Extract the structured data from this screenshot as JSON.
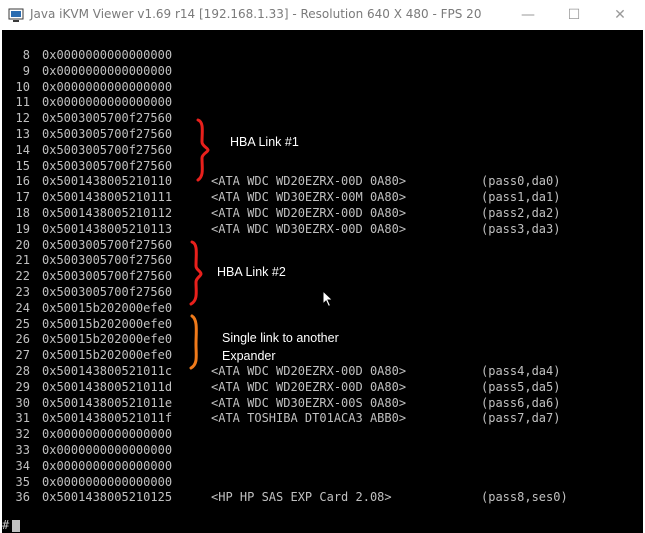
{
  "window": {
    "title": "Java iKVM Viewer v1.69 r14 [192.168.1.33]  - Resolution 640 X 480 - FPS 20",
    "minimize_glyph": "—",
    "maximize_glyph": "☐",
    "close_glyph": "✕"
  },
  "terminal": {
    "lines": [
      {
        "num": "8",
        "addr": "0x0000000000000000",
        "dev": "",
        "pass": ""
      },
      {
        "num": "9",
        "addr": "0x0000000000000000",
        "dev": "",
        "pass": ""
      },
      {
        "num": "10",
        "addr": "0x0000000000000000",
        "dev": "",
        "pass": ""
      },
      {
        "num": "11",
        "addr": "0x0000000000000000",
        "dev": "",
        "pass": ""
      },
      {
        "num": "12",
        "addr": "0x5003005700f27560",
        "dev": "",
        "pass": ""
      },
      {
        "num": "13",
        "addr": "0x5003005700f27560",
        "dev": "",
        "pass": ""
      },
      {
        "num": "14",
        "addr": "0x5003005700f27560",
        "dev": "",
        "pass": ""
      },
      {
        "num": "15",
        "addr": "0x5003005700f27560",
        "dev": "",
        "pass": ""
      },
      {
        "num": "16",
        "addr": "0x5001438005210110",
        "dev": "<ATA WDC WD20EZRX-00D 0A80>",
        "pass": "(pass0,da0)"
      },
      {
        "num": "17",
        "addr": "0x5001438005210111",
        "dev": "<ATA WDC WD30EZRX-00M 0A80>",
        "pass": "(pass1,da1)"
      },
      {
        "num": "18",
        "addr": "0x5001438005210112",
        "dev": "<ATA WDC WD20EZRX-00D 0A80>",
        "pass": "(pass2,da2)"
      },
      {
        "num": "19",
        "addr": "0x5001438005210113",
        "dev": "<ATA WDC WD30EZRX-00D 0A80>",
        "pass": "(pass3,da3)"
      },
      {
        "num": "20",
        "addr": "0x5003005700f27560",
        "dev": "",
        "pass": ""
      },
      {
        "num": "21",
        "addr": "0x5003005700f27560",
        "dev": "",
        "pass": ""
      },
      {
        "num": "22",
        "addr": "0x5003005700f27560",
        "dev": "",
        "pass": ""
      },
      {
        "num": "23",
        "addr": "0x5003005700f27560",
        "dev": "",
        "pass": ""
      },
      {
        "num": "24",
        "addr": "0x50015b202000efe0",
        "dev": "",
        "pass": ""
      },
      {
        "num": "25",
        "addr": "0x50015b202000efe0",
        "dev": "",
        "pass": ""
      },
      {
        "num": "26",
        "addr": "0x50015b202000efe0",
        "dev": "",
        "pass": ""
      },
      {
        "num": "27",
        "addr": "0x50015b202000efe0",
        "dev": "",
        "pass": ""
      },
      {
        "num": "28",
        "addr": "0x500143800521011c",
        "dev": "<ATA WDC WD20EZRX-00D 0A80>",
        "pass": "(pass4,da4)"
      },
      {
        "num": "29",
        "addr": "0x500143800521011d",
        "dev": "<ATA WDC WD20EZRX-00D 0A80>",
        "pass": "(pass5,da5)"
      },
      {
        "num": "30",
        "addr": "0x500143800521011e",
        "dev": "<ATA WDC WD30EZRX-00S 0A80>",
        "pass": "(pass6,da6)"
      },
      {
        "num": "31",
        "addr": "0x500143800521011f",
        "dev": "<ATA TOSHIBA DT01ACA3 ABB0>",
        "pass": "(pass7,da7)"
      },
      {
        "num": "32",
        "addr": "0x0000000000000000",
        "dev": "",
        "pass": ""
      },
      {
        "num": "33",
        "addr": "0x0000000000000000",
        "dev": "",
        "pass": ""
      },
      {
        "num": "34",
        "addr": "0x0000000000000000",
        "dev": "",
        "pass": ""
      },
      {
        "num": "35",
        "addr": "0x0000000000000000",
        "dev": "",
        "pass": ""
      },
      {
        "num": "36",
        "addr": "0x5001438005210125",
        "dev": "<HP HP SAS EXP Card 2.08>",
        "pass": "(pass8,ses0)"
      }
    ],
    "prompt": "#"
  },
  "annotations": {
    "hba1": "HBA Link #1",
    "hba2": "HBA Link #2",
    "single_line1": "Single link to another",
    "single_line2": "Expander",
    "red_color": "#e8201c",
    "orange_color": "#f07a1a"
  }
}
